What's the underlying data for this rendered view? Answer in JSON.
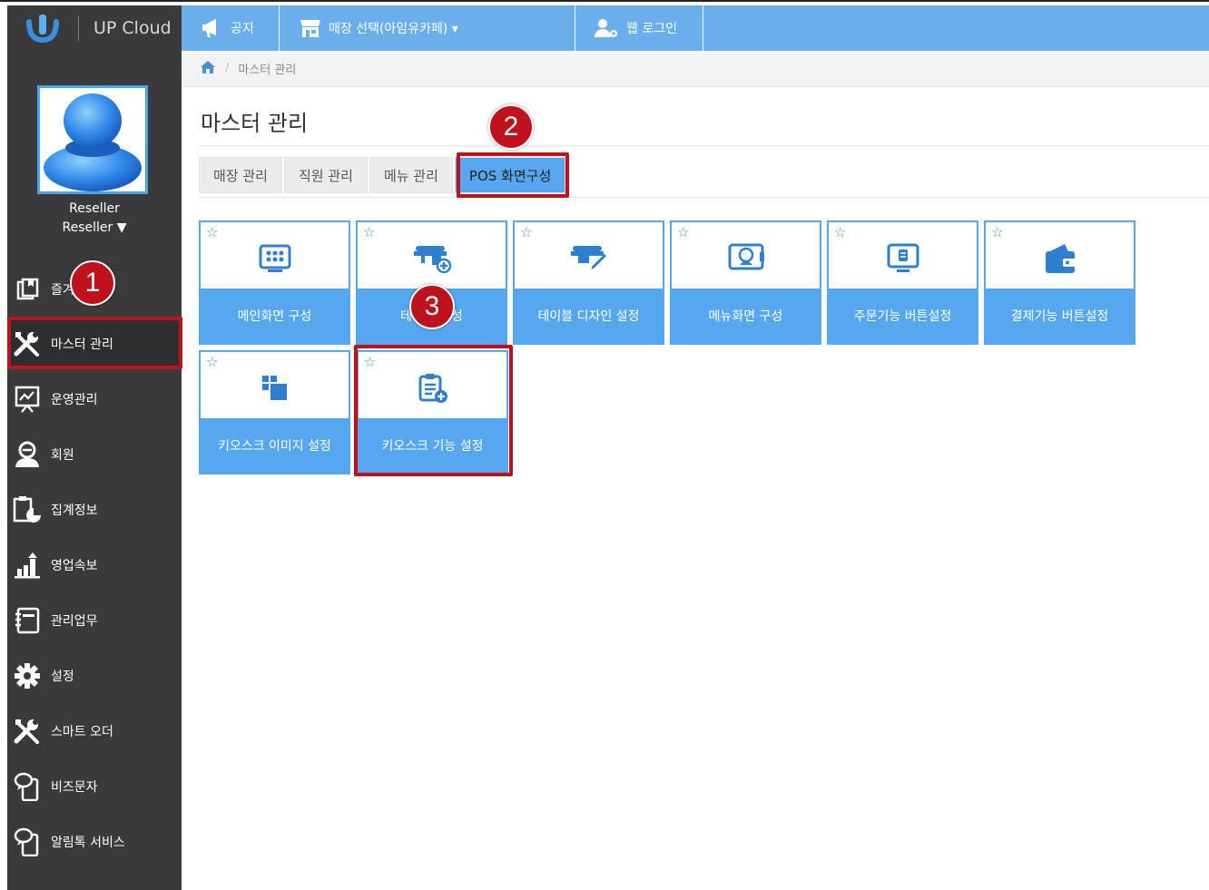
{
  "brand": {
    "name": "UP Cloud"
  },
  "user": {
    "name": "Reseller",
    "role": "Reseller ▼"
  },
  "sidebar": {
    "items": [
      {
        "label": "즐겨찾기",
        "icon": "bookmark-icon"
      },
      {
        "label": "마스터 관리",
        "icon": "tools-icon"
      },
      {
        "label": "운영관리",
        "icon": "chart-board-icon"
      },
      {
        "label": "회원",
        "icon": "member-icon"
      },
      {
        "label": "집계정보",
        "icon": "clipboard-chart-icon"
      },
      {
        "label": "영업속보",
        "icon": "bar-chart-icon"
      },
      {
        "label": "관리업무",
        "icon": "notebook-icon"
      },
      {
        "label": "설정",
        "icon": "gear-icon"
      },
      {
        "label": "스마트 오더",
        "icon": "tools-icon"
      },
      {
        "label": "비즈문자",
        "icon": "phone-chat-icon"
      },
      {
        "label": "알림톡 서비스",
        "icon": "phone-chat-icon"
      }
    ]
  },
  "topbar": {
    "notice": "공지",
    "store_select": "매장 선택(아임유카페) ▾",
    "web_login": "웹 로그인"
  },
  "breadcrumb": {
    "current": "마스터 관리"
  },
  "page": {
    "title": "마스터 관리"
  },
  "tabs": [
    "매장 관리",
    "직원 관리",
    "메뉴 관리",
    "POS 화면구성"
  ],
  "cards": [
    {
      "label": "메인화면 구성",
      "icon": "grid-screen-icon"
    },
    {
      "label": "테이블 구성",
      "icon": "table-add-icon"
    },
    {
      "label": "테이블 디자인 설정",
      "icon": "table-edit-icon"
    },
    {
      "label": "메뉴화면 구성",
      "icon": "menu-screen-icon"
    },
    {
      "label": "주문기능 버튼설정",
      "icon": "order-monitor-icon"
    },
    {
      "label": "결제기능 버튼설정",
      "icon": "wallet-icon"
    },
    {
      "label": "키오스크 이미지 설정",
      "icon": "blocks-icon"
    },
    {
      "label": "키오스크 기능 설정",
      "icon": "clipboard-add-icon"
    }
  ],
  "annotations": {
    "badge1": "1",
    "badge2": "2",
    "badge3": "3"
  },
  "colors": {
    "accent": "#56a7f0",
    "sidebar": "#3a3a3a",
    "highlight": "#c0121d"
  }
}
